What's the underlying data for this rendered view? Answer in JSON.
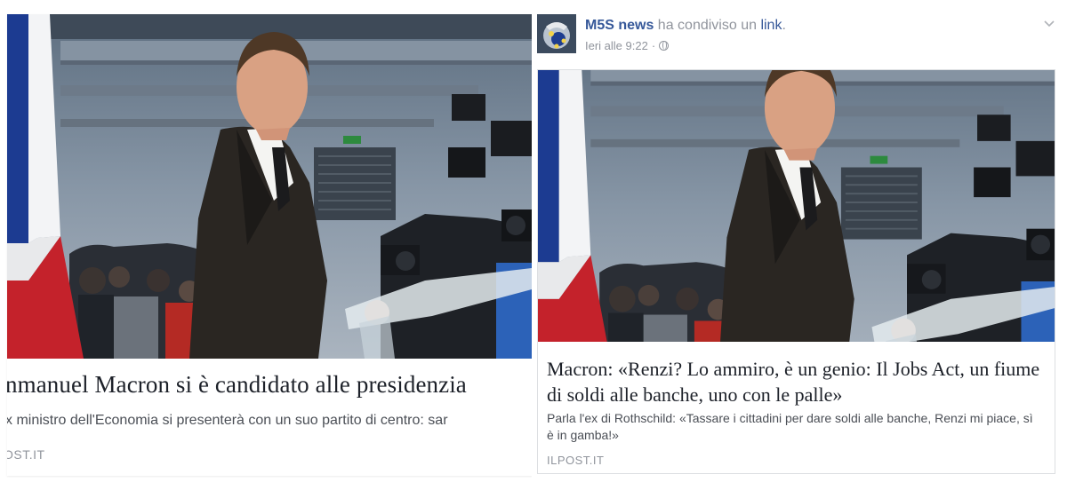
{
  "left_card": {
    "headline": "nmanuel Macron si è candidato alle presidenzia",
    "description": "x ministro dell'Economia si presenterà con un suo partito di centro: sar",
    "source": "OST.IT"
  },
  "right_post": {
    "page_name": "M5S news",
    "shared_text": " ha condiviso un ",
    "link_word": "link",
    "period": ".",
    "timestamp": "Ieri alle 9:22",
    "meta_separator": " · ",
    "privacy_icon": "globe-icon",
    "menu_icon": "chevron-down-icon",
    "card": {
      "headline": "Macron: «Renzi? Lo ammiro, è un genio: Il Jobs Act, un fiume di soldi alle banche, uno con le palle»",
      "description": "Parla l'ex di Rothschild: «Tassare i cittadini per dare soldi alle banche, Renzi mi piace, sì è in gamba!»",
      "source": "ILPOST.IT"
    }
  },
  "colors": {
    "link_blue": "#365899",
    "headline_text": "#1d2129",
    "body_text": "#4b4f56",
    "meta_gray": "#90949c"
  }
}
